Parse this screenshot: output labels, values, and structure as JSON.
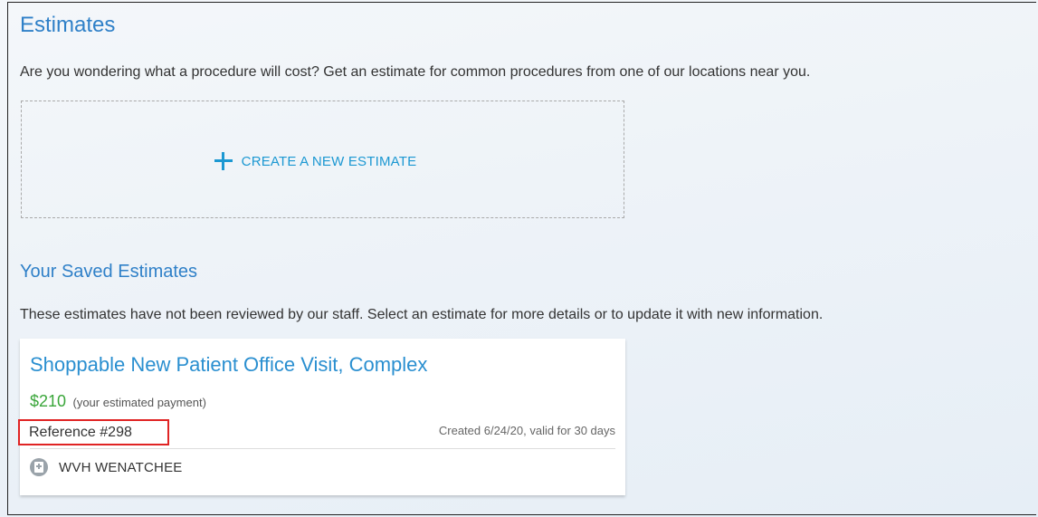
{
  "page": {
    "title": "Estimates",
    "intro": "Are you wondering what a procedure will cost? Get an estimate for common procedures from one of our locations near you."
  },
  "create": {
    "icon": "plus-icon",
    "label": "CREATE A NEW ESTIMATE"
  },
  "saved": {
    "heading": "Your Saved Estimates",
    "description": "These estimates have not been reviewed by our staff. Select an estimate for more details or to update it with new information.",
    "estimates": [
      {
        "title": "Shoppable New Patient Office Visit, Complex",
        "price": "$210",
        "price_note": "(your estimated payment)",
        "reference": "Reference #298",
        "created": "Created 6/24/20, valid for 30 days",
        "location_icon": "hospital-icon",
        "location": "WVH WENATCHEE"
      }
    ]
  },
  "colors": {
    "heading": "#2f80c8",
    "link": "#1c98d2",
    "price": "#3aa63a",
    "highlight": "#e02424"
  }
}
